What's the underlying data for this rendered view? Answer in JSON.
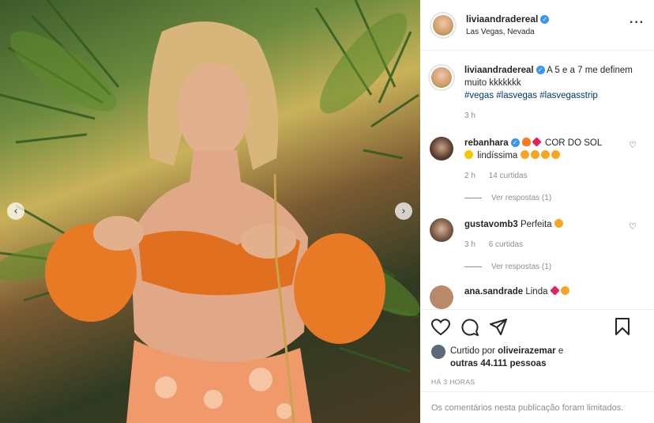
{
  "post": {
    "username": "liviaandradereal",
    "location": "Las Vegas, Nevada",
    "caption_text": "A 5 e a 7 me definem muito kkkkkkk",
    "hashtags": "#vegas #lasvegas #lasvegasstrip",
    "caption_time": "3 h"
  },
  "comments": [
    {
      "username": "rebanhara",
      "text_a": "COR DO SOL",
      "text_b": "lindíssima",
      "time": "2 h",
      "likes": "14 curtidas",
      "replies": "Ver respostas (1)"
    },
    {
      "username": "gustavomb3",
      "text": "Perfeita",
      "time": "3 h",
      "likes": "6 curtidas",
      "replies": "Ver respostas (1)"
    },
    {
      "username": "ana.sandrade",
      "text": "Linda"
    }
  ],
  "likes": {
    "prefix": "Curtido por",
    "user": "oliveirazemar",
    "connector": "e",
    "others": "outras 44.111 pessoas"
  },
  "timestamp": "HÁ 3 HORAS",
  "comments_limited": "Os comentários nesta publicação foram limitados.",
  "icons": {
    "like": "heart-icon",
    "comment": "comment-icon",
    "share": "share-icon",
    "save": "bookmark-icon",
    "more": "more-icon",
    "prev": "chevron-left-icon",
    "next": "chevron-right-icon"
  },
  "colors": {
    "link": "#00376b",
    "muted": "#8e8e8e",
    "verified": "#3897f0"
  }
}
